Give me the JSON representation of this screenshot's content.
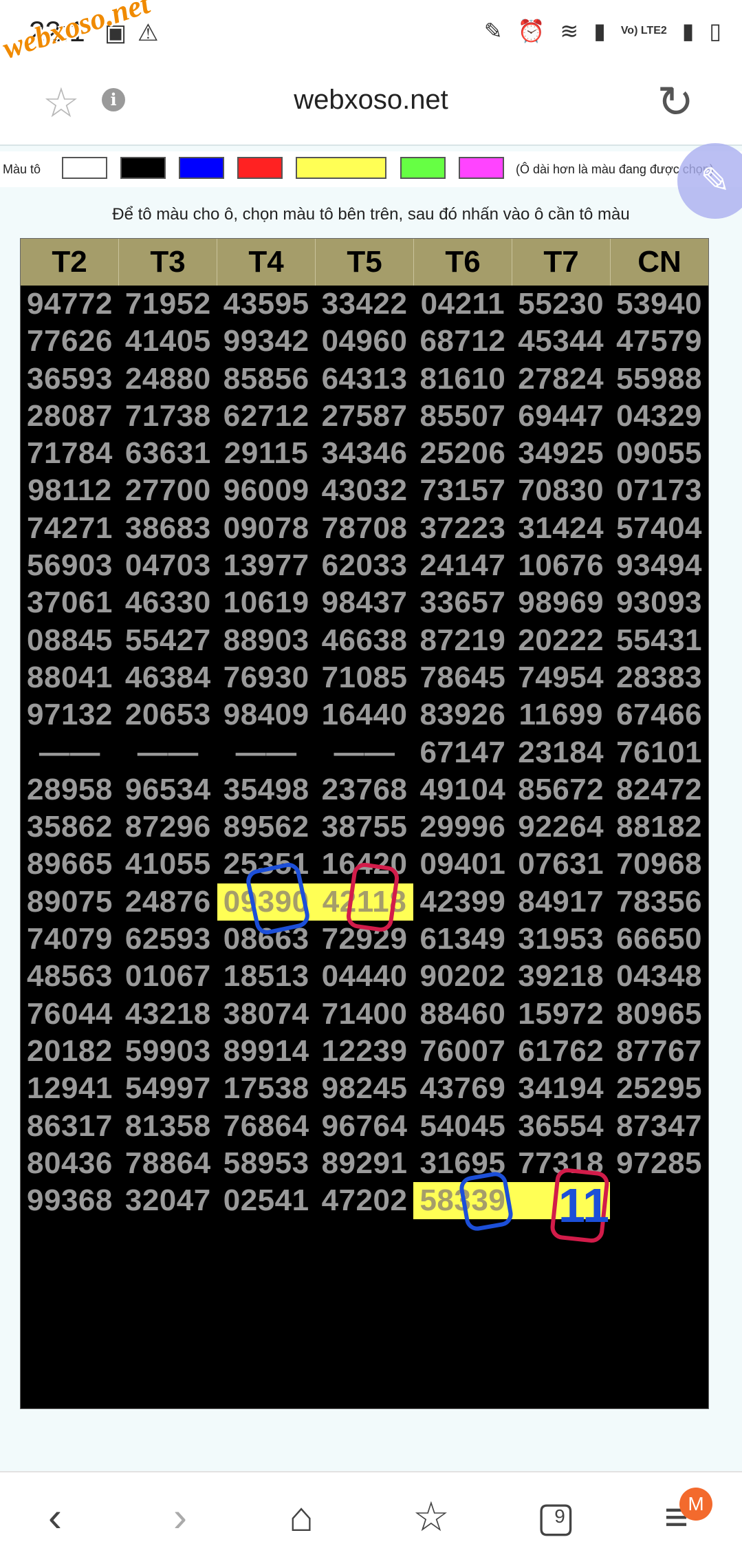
{
  "status_bar": {
    "time": "22:1",
    "watermark": "webxoso.net",
    "lte_label": "Vo) LTE2"
  },
  "browser": {
    "url": "webxoso.net",
    "tab_count": "9",
    "profile_badge": "M"
  },
  "palette": {
    "label": "Màu tô",
    "hint": "(Ô dài hơn là màu đang được chọn)",
    "colors": [
      "#ffffff",
      "#000000",
      "#0000ff",
      "#ff2222",
      "#ffff55",
      "#66ff44",
      "#ff44ff"
    ]
  },
  "instruction": "Để tô màu cho ô, chọn màu tô bên trên, sau đó nhấn vào ô cần tô màu",
  "table": {
    "headers": [
      "T2",
      "T3",
      "T4",
      "T5",
      "T6",
      "T7",
      "CN"
    ],
    "rows": [
      [
        "94772",
        "71952",
        "43595",
        "33422",
        "04211",
        "55230",
        "53940"
      ],
      [
        "77626",
        "41405",
        "99342",
        "04960",
        "68712",
        "45344",
        "47579"
      ],
      [
        "36593",
        "24880",
        "85856",
        "64313",
        "81610",
        "27824",
        "55988"
      ],
      [
        "28087",
        "71738",
        "62712",
        "27587",
        "85507",
        "69447",
        "04329"
      ],
      [
        "71784",
        "63631",
        "29115",
        "34346",
        "25206",
        "34925",
        "09055"
      ],
      [
        "98112",
        "27700",
        "96009",
        "43032",
        "73157",
        "70830",
        "07173"
      ],
      [
        "74271",
        "38683",
        "09078",
        "78708",
        "37223",
        "31424",
        "57404"
      ],
      [
        "56903",
        "04703",
        "13977",
        "62033",
        "24147",
        "10676",
        "93494"
      ],
      [
        "37061",
        "46330",
        "10619",
        "98437",
        "33657",
        "98969",
        "93093"
      ],
      [
        "08845",
        "55427",
        "88903",
        "46638",
        "87219",
        "20222",
        "55431"
      ],
      [
        "88041",
        "46384",
        "76930",
        "71085",
        "78645",
        "74954",
        "28383"
      ],
      [
        "97132",
        "20653",
        "98409",
        "16440",
        "83926",
        "11699",
        "67466"
      ],
      [
        "——",
        "——",
        "——",
        "——",
        "67147",
        "23184",
        "76101"
      ],
      [
        "28958",
        "96534",
        "35498",
        "23768",
        "49104",
        "85672",
        "82472"
      ],
      [
        "35862",
        "87296",
        "89562",
        "38755",
        "29996",
        "92264",
        "88182"
      ],
      [
        "89665",
        "41055",
        "25351",
        "16420",
        "09401",
        "07631",
        "70968"
      ],
      [
        "89075",
        "24876",
        "09390",
        "42118",
        "42399",
        "84917",
        "78356"
      ],
      [
        "74079",
        "62593",
        "08663",
        "72929",
        "61349",
        "31953",
        "66650"
      ],
      [
        "48563",
        "01067",
        "18513",
        "04440",
        "90202",
        "39218",
        "04348"
      ],
      [
        "76044",
        "43218",
        "38074",
        "71400",
        "88460",
        "15972",
        "80965"
      ],
      [
        "20182",
        "59903",
        "89914",
        "12239",
        "76007",
        "61762",
        "87767"
      ],
      [
        "12941",
        "54997",
        "17538",
        "98245",
        "43769",
        "34194",
        "25295"
      ],
      [
        "86317",
        "81358",
        "76864",
        "96764",
        "54045",
        "36554",
        "87347"
      ],
      [
        "80436",
        "78864",
        "58953",
        "89291",
        "31695",
        "77318",
        "97285"
      ],
      [
        "99368",
        "32047",
        "02541",
        "47202",
        "58339",
        "",
        ""
      ]
    ],
    "highlighted": [
      [
        16,
        2
      ],
      [
        16,
        3
      ],
      [
        24,
        4
      ],
      [
        24,
        5
      ]
    ]
  },
  "annotation_text": "11"
}
